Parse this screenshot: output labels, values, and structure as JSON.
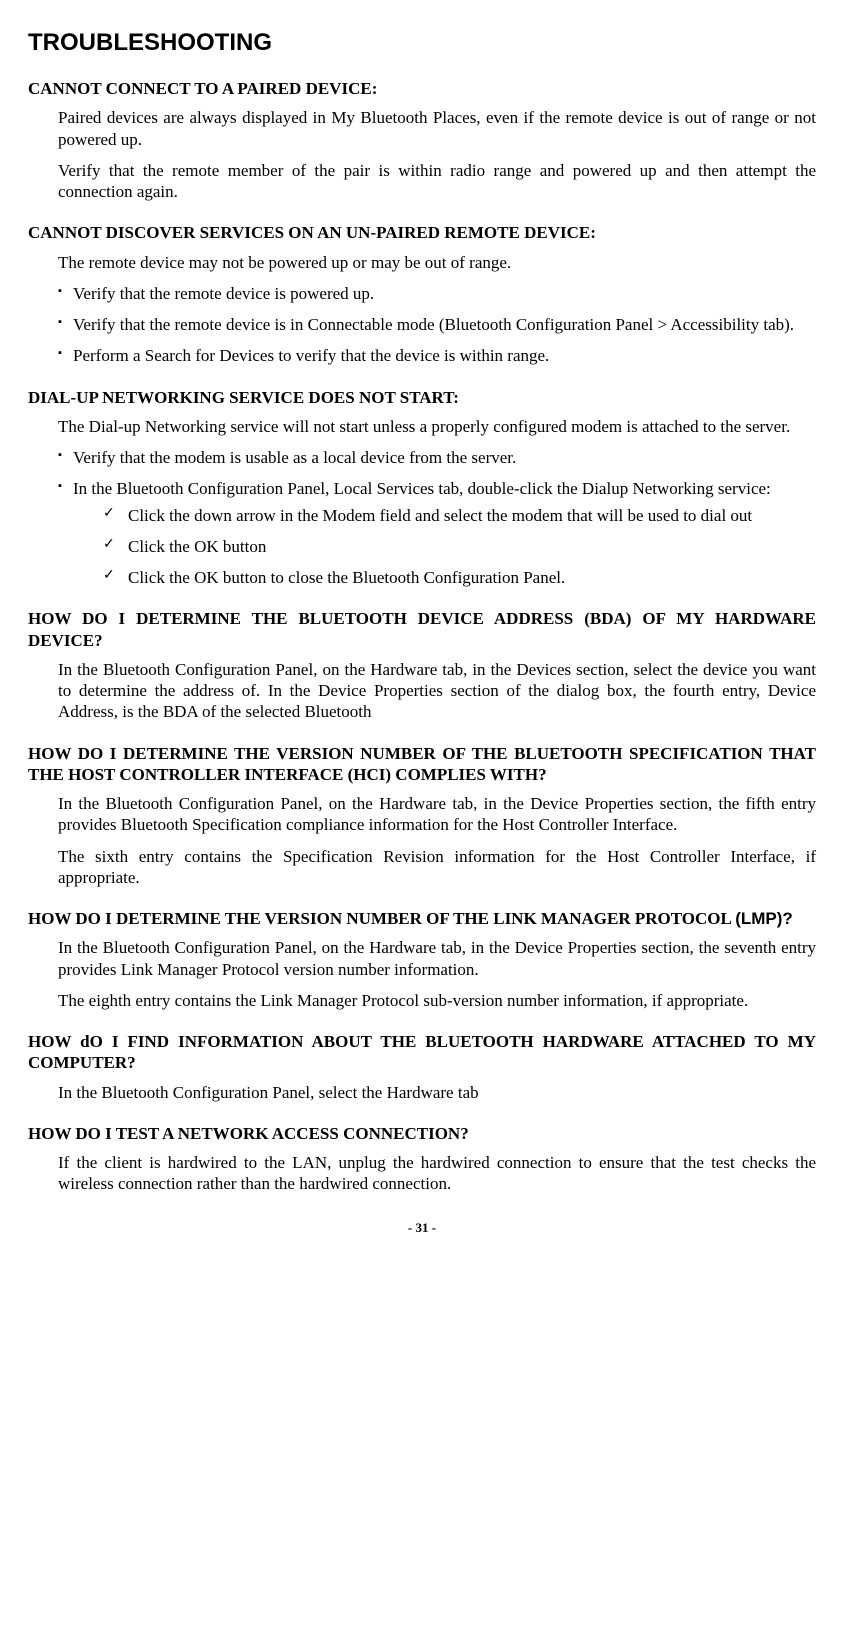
{
  "title": "TROUBLESHOOTING",
  "sections": [
    {
      "heading": "CANNOT CONNECT TO A PAIRED DEVICE:",
      "paras": [
        "Paired devices are always displayed in My Bluetooth Places, even if the remote device is out of range or not powered up.",
        "Verify that the remote member of the pair is within radio range and powered up and then attempt the connection again."
      ]
    },
    {
      "heading": "CANNOT DISCOVER SERVICES ON AN UN-PAIRED REMOTE DEVICE:",
      "paras": [
        "The remote device may not be powered up or may be out of range."
      ],
      "bullets": [
        "Verify that the remote device is powered up.",
        "Verify that the remote device is in Connectable mode (Bluetooth Configuration Panel > Accessibility tab).",
        "Perform a Search for Devices to verify that the device is within range."
      ]
    },
    {
      "heading": "DIAL-UP NETWORKING SERVICE DOES NOT START:",
      "paras": [
        "The Dial-up Networking service will not start unless a properly configured modem is attached to the server."
      ],
      "bullets": [
        "Verify that the modem is usable as a local device from the server.",
        "In the Bluetooth Configuration Panel, Local Services tab, double-click the Dialup Networking service:"
      ],
      "checks": [
        "Click the down arrow in the Modem field and select the modem that will be used to dial out",
        "Click the OK button",
        "Click the OK button to close the Bluetooth Configuration Panel."
      ]
    },
    {
      "heading": "HOW DO I DETERMINE THE BLUETOOTH DEVICE ADDRESS (BDA) OF MY HARDWARE DEVICE?",
      "paras": [
        "In the Bluetooth Configuration Panel, on the Hardware tab, in the Devices section, select the device you want to determine the address of. In the Device Properties section of the dialog box, the fourth entry, Device Address, is the BDA of the selected Bluetooth"
      ]
    },
    {
      "heading": "HOW DO I DETERMINE THE VERSION NUMBER OF THE BLUETOOTH SPECIFICATION THAT THE HOST CONTROLLER INTERFACE (HCI) COMPLIES WITH?",
      "paras": [
        "In the Bluetooth Configuration Panel, on the Hardware tab, in the Device Properties section, the fifth entry provides Bluetooth Specification compliance information for the Host Controller Interface.",
        "The sixth entry contains the Specification Revision information for the Host Controller Interface, if appropriate."
      ]
    },
    {
      "heading_parts": [
        "HOW DO I DETERMINE THE VERSION NUMBER OF THE LINK MANAGER PROTOCOL ",
        "(LMP)?"
      ],
      "paras": [
        "In the Bluetooth Configuration Panel, on the Hardware tab, in the Device Properties section, the seventh entry provides Link Manager Protocol version number information.",
        "The eighth entry contains the Link Manager Protocol sub-version number information, if appropriate."
      ]
    },
    {
      "heading": "HOW dO I FIND INFORMATION ABOUT THE BLUETOOTH HARDWARE ATTACHED TO MY COMPUTER?",
      "paras": [
        "In the Bluetooth Configuration Panel, select the Hardware tab"
      ]
    },
    {
      "heading": "HOW DO I TEST A NETWORK ACCESS CONNECTION?",
      "paras": [
        "If the client is hardwired to the LAN, unplug the hardwired connection to ensure that the test checks the wireless connection rather than the hardwired connection."
      ]
    }
  ],
  "pageNumber": "- 31 -"
}
